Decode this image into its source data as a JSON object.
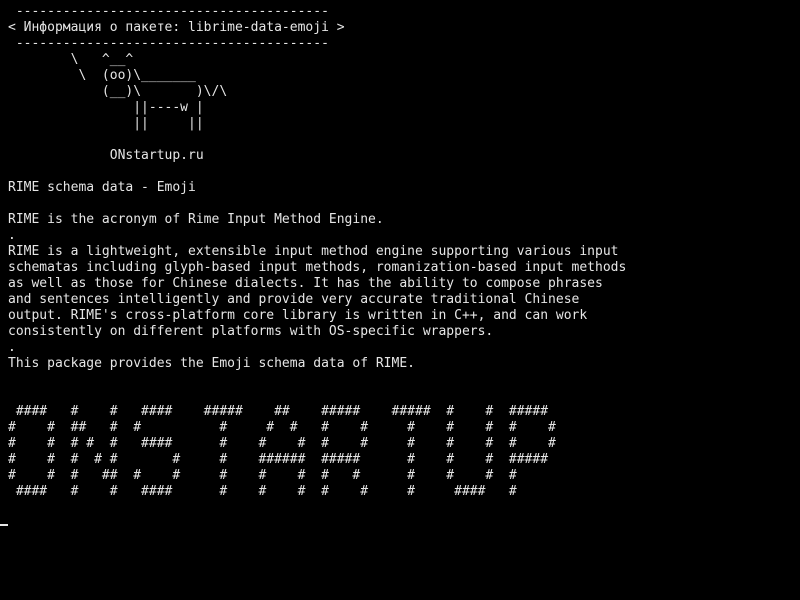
{
  "terminal": {
    "bubble_top": " ----------------------------------------",
    "bubble_text": "< Информация о пакете: librime-data-emoji >",
    "bubble_bottom": " ----------------------------------------",
    "cow": [
      "        \\   ^__^",
      "         \\  (oo)\\_______",
      "            (__)\\       )\\/\\",
      "                ||----w |",
      "                ||     ||"
    ],
    "site": "             ONstartup.ru",
    "summary": "RIME schema data - Emoji",
    "description_intro": "RIME is the acronym of Rime Input Method Engine.",
    "dot_1": ".",
    "description": [
      "RIME is a lightweight, extensible input method engine supporting various input",
      "schematas including glyph-based input methods, romanization-based input methods",
      "as well as those for Chinese dialects. It has the ability to compose phrases",
      "and sentences intelligently and provide very accurate traditional Chinese",
      "output. RIME's cross-platform core library is written in C++, and can work",
      "consistently on different platforms with OS-specific wrappers."
    ],
    "dot_2": ".",
    "package_note": "This package provides the Emoji schema data of RIME.",
    "banner": [
      " ####   #    #   ####    #####    ##    #####    #####  #    #  #####",
      "#    #  ##   #  #          #     #  #   #    #     #    #    #  #    #",
      "#    #  # #  #   ####      #    #    #  #    #     #    #    #  #    #",
      "#    #  #  # #       #     #    ######  #####      #    #    #  #####",
      "#    #  #   ##  #    #     #    #    #  #   #      #    #    #  #",
      " ####   #    #   ####      #    #    #  #    #     #     ####   #"
    ]
  }
}
